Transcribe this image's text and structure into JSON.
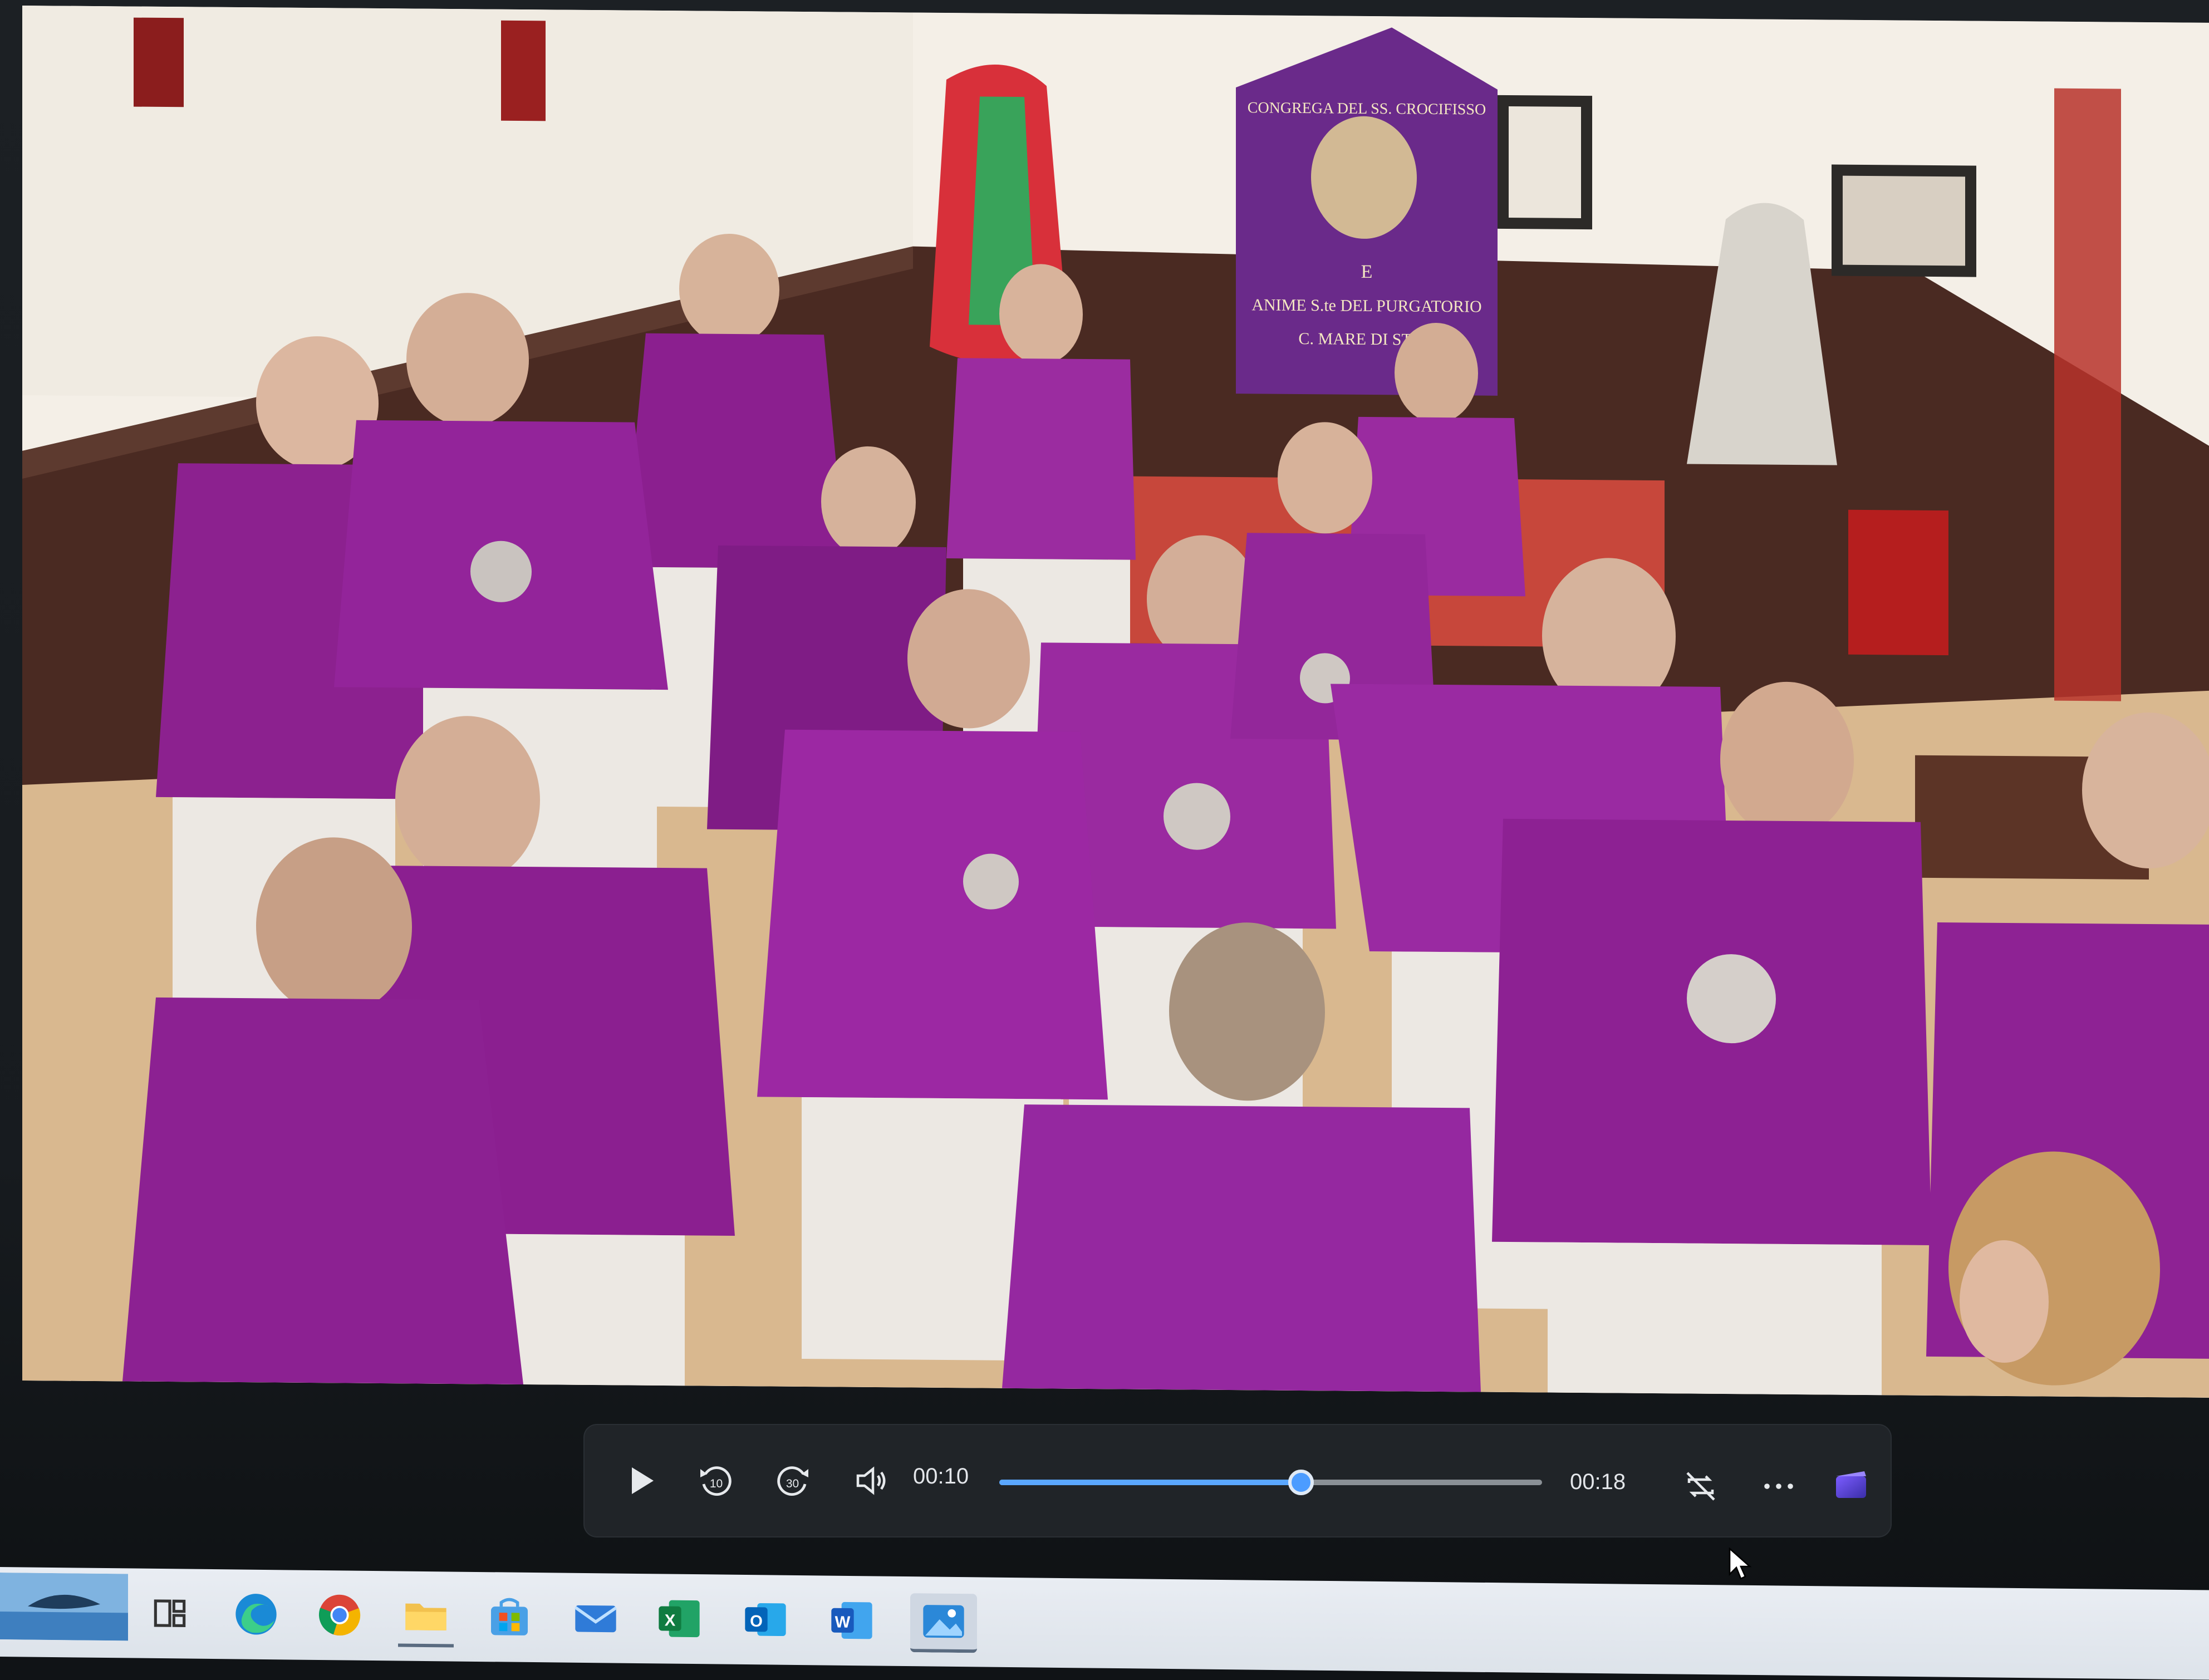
{
  "player": {
    "elapsed": "00:10",
    "duration": "00:18",
    "progress_fraction": 0.556,
    "accent_color": "#4c9cff"
  },
  "controls": {
    "play_icon": "play-icon",
    "rewind_icon": "rewind-10-icon",
    "rewind_label": "10",
    "forward_icon": "forward-30-icon",
    "forward_label": "30",
    "volume_icon": "volume-icon",
    "repeat_icon": "repeat-off-icon",
    "more_icon": "more-options-icon",
    "clipchamp_icon": "clipchamp-icon"
  },
  "video": {
    "banner_text_top": "CONGREGA DEL SS. CROCIFISSO",
    "banner_text_mid": "E",
    "banner_text_line3": "ANIME S.te DEL PURGATORIO",
    "banner_text_line4": "C. MARE DI STA..."
  },
  "taskbar": {
    "items": [
      {
        "icon": "desktop-thumbnail-icon"
      },
      {
        "icon": "task-view-icon"
      },
      {
        "icon": "edge-icon"
      },
      {
        "icon": "chrome-icon"
      },
      {
        "icon": "file-explorer-icon"
      },
      {
        "icon": "store-icon"
      },
      {
        "icon": "mail-icon"
      },
      {
        "icon": "excel-icon",
        "letter": "X"
      },
      {
        "icon": "outlook-icon",
        "letter": "O"
      },
      {
        "icon": "word-icon",
        "letter": "W"
      },
      {
        "icon": "photos-icon"
      }
    ]
  }
}
